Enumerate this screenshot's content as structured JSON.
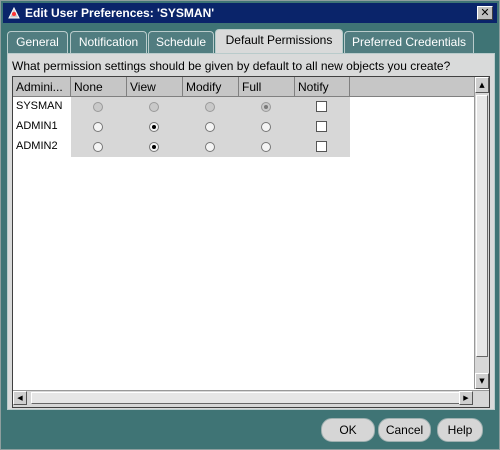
{
  "window": {
    "title": "Edit User Preferences: 'SYSMAN'",
    "close_glyph": "✕"
  },
  "tabs": [
    {
      "label": "General",
      "active": false
    },
    {
      "label": "Notification",
      "active": false
    },
    {
      "label": "Schedule",
      "active": false
    },
    {
      "label": "Default Permissions",
      "active": true
    },
    {
      "label": "Preferred Credentials",
      "active": false
    }
  ],
  "prompt": "What permission settings should be given by default to all new objects you create?",
  "table": {
    "columns": [
      "Admini...",
      "None",
      "View",
      "Modify",
      "Full",
      "Notify"
    ],
    "rows": [
      {
        "name": "SYSMAN",
        "selected": "Full",
        "enabled": false,
        "notify": false
      },
      {
        "name": "ADMIN1",
        "selected": "View",
        "enabled": true,
        "notify": false
      },
      {
        "name": "ADMIN2",
        "selected": "View",
        "enabled": true,
        "notify": false
      }
    ]
  },
  "buttons": {
    "ok": "OK",
    "cancel": "Cancel",
    "help": "Help"
  },
  "icons": {
    "app": "app-icon",
    "scroll_up": "▲",
    "scroll_down": "▼",
    "scroll_left": "◀",
    "scroll_right": "▶"
  }
}
